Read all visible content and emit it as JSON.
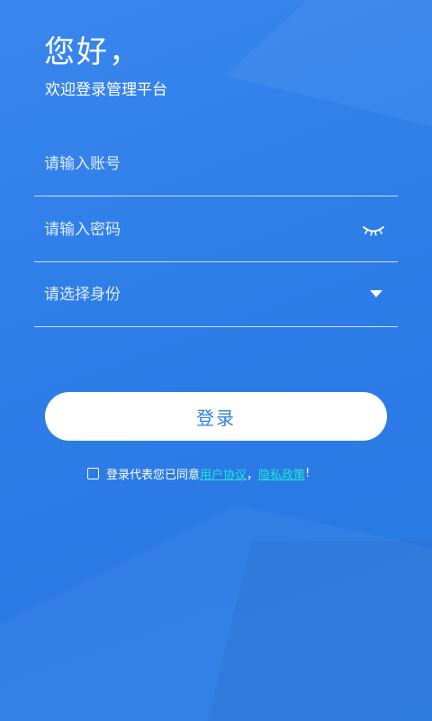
{
  "header": {
    "greeting": "您好，",
    "subtitle": "欢迎登录管理平台"
  },
  "form": {
    "account": {
      "placeholder": "请输入账号",
      "value": ""
    },
    "password": {
      "placeholder": "请输入密码",
      "value": "",
      "toggle_icon": "eye-closed-icon"
    },
    "identity": {
      "placeholder": "请选择身份",
      "icon": "dropdown-triangle-icon"
    }
  },
  "login_button": {
    "label": "登录"
  },
  "agreement": {
    "checked": false,
    "prefix": "登录代表您已同意",
    "user_agreement": "用户协议",
    "separator": "，",
    "privacy_policy": "隐私政策",
    "suffix": "!",
    "link_color": "#1ee6d8"
  },
  "colors": {
    "background": "#2f7fe9",
    "button_text": "#2f7fe9",
    "button_bg": "#ffffff"
  }
}
